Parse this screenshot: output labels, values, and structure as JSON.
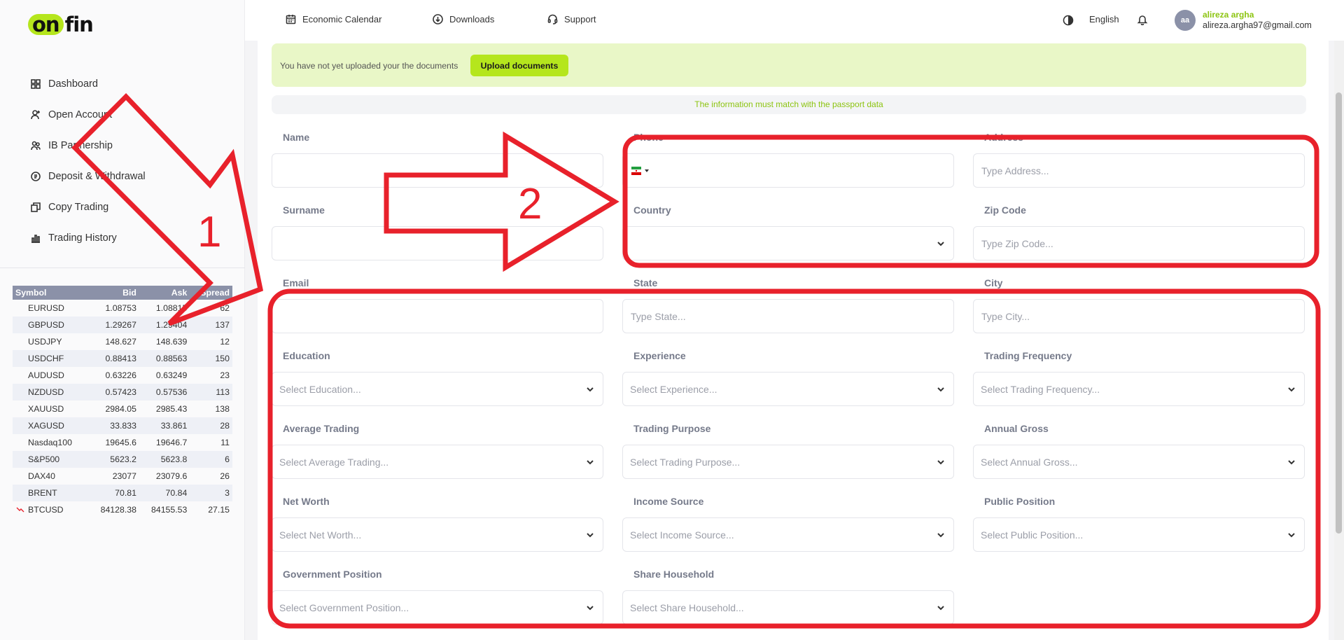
{
  "brand": {
    "logo_on": "on",
    "logo_fin": "fin"
  },
  "sidebar": {
    "items": [
      {
        "label": "Dashboard",
        "icon": "grid-icon"
      },
      {
        "label": "Open Account",
        "icon": "user-plus-icon"
      },
      {
        "label": "IB Partnership",
        "icon": "users-icon"
      },
      {
        "label": "Deposit & Withdrawal",
        "icon": "coin-icon"
      },
      {
        "label": "Copy Trading",
        "icon": "copy-icon"
      },
      {
        "label": "Trading History",
        "icon": "bar-chart-icon"
      }
    ]
  },
  "quotes": {
    "headers": [
      "Symbol",
      "Bid",
      "Ask",
      "Spread"
    ],
    "rows": [
      {
        "symbol": "EURUSD",
        "bid": "1.08753",
        "ask": "1.08815",
        "spread": "62"
      },
      {
        "symbol": "GBPUSD",
        "bid": "1.29267",
        "ask": "1.29404",
        "spread": "137"
      },
      {
        "symbol": "USDJPY",
        "bid": "148.627",
        "ask": "148.639",
        "spread": "12"
      },
      {
        "symbol": "USDCHF",
        "bid": "0.88413",
        "ask": "0.88563",
        "spread": "150"
      },
      {
        "symbol": "AUDUSD",
        "bid": "0.63226",
        "ask": "0.63249",
        "spread": "23"
      },
      {
        "symbol": "NZDUSD",
        "bid": "0.57423",
        "ask": "0.57536",
        "spread": "113"
      },
      {
        "symbol": "XAUUSD",
        "bid": "2984.05",
        "ask": "2985.43",
        "spread": "138"
      },
      {
        "symbol": "XAGUSD",
        "bid": "33.833",
        "ask": "33.861",
        "spread": "28"
      },
      {
        "symbol": "Nasdaq100",
        "bid": "19645.6",
        "ask": "19646.7",
        "spread": "11"
      },
      {
        "symbol": "S&P500",
        "bid": "5623.2",
        "ask": "5623.8",
        "spread": "6"
      },
      {
        "symbol": "DAX40",
        "bid": "23077",
        "ask": "23079.6",
        "spread": "26"
      },
      {
        "symbol": "BRENT",
        "bid": "70.81",
        "ask": "70.84",
        "spread": "3"
      },
      {
        "symbol": "BTCUSD",
        "bid": "84128.38",
        "ask": "84155.53",
        "spread": "27.15",
        "trend": "down"
      }
    ]
  },
  "header": {
    "economic_calendar": "Economic Calendar",
    "downloads": "Downloads",
    "support": "Support",
    "language": "English",
    "avatar_initials": "aa",
    "user_name": "alireza argha",
    "user_email": "alireza.argha97@gmail.com"
  },
  "banner": {
    "text": "You have not yet uploaded your the documents",
    "button": "Upload documents"
  },
  "info": "The information must match with the passport data",
  "form": {
    "name": {
      "label": "Name",
      "placeholder": ""
    },
    "phone": {
      "label": "Phone"
    },
    "address": {
      "label": "Address",
      "placeholder": "Type Address..."
    },
    "surname": {
      "label": "Surname",
      "placeholder": ""
    },
    "country": {
      "label": "Country",
      "placeholder": ""
    },
    "zip": {
      "label": "Zip Code",
      "placeholder": "Type Zip Code..."
    },
    "email": {
      "label": "Email",
      "placeholder": ""
    },
    "state": {
      "label": "State",
      "placeholder": "Type State..."
    },
    "city": {
      "label": "City",
      "placeholder": "Type City..."
    },
    "education": {
      "label": "Education",
      "placeholder": "Select Education..."
    },
    "experience": {
      "label": "Experience",
      "placeholder": "Select Experience..."
    },
    "trading_frequency": {
      "label": "Trading Frequency",
      "placeholder": "Select Trading Frequency..."
    },
    "average_trading": {
      "label": "Average Trading",
      "placeholder": "Select Average Trading..."
    },
    "trading_purpose": {
      "label": "Trading Purpose",
      "placeholder": "Select Trading Purpose..."
    },
    "annual_gross": {
      "label": "Annual Gross",
      "placeholder": "Select Annual Gross..."
    },
    "net_worth": {
      "label": "Net Worth",
      "placeholder": "Select Net Worth..."
    },
    "income_source": {
      "label": "Income Source",
      "placeholder": "Select Income Source..."
    },
    "public_position": {
      "label": "Public Position",
      "placeholder": "Select Public Position..."
    },
    "government_position": {
      "label": "Government Position",
      "placeholder": "Select Government Position..."
    },
    "share_household": {
      "label": "Share Household",
      "placeholder": "Select Share Household..."
    }
  },
  "annotations": {
    "label_1": "1",
    "label_2": "2",
    "color": "#e8212b"
  },
  "colors": {
    "accent": "#b5e61d",
    "banner_bg": "#e9f7c7",
    "info_text": "#8cc410",
    "table_header": "#8b91a8"
  }
}
